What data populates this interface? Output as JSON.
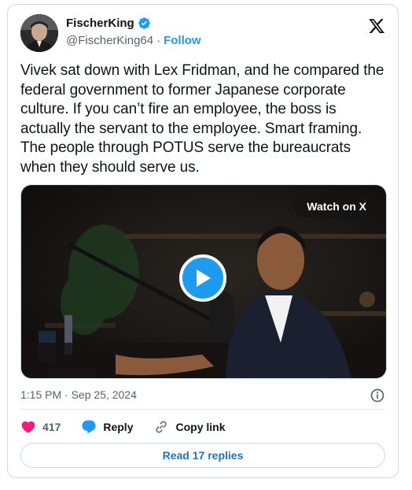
{
  "author": {
    "display_name": "FischerKing",
    "handle": "@FischerKing64",
    "separator": "·",
    "follow_label": "Follow"
  },
  "tweet": {
    "text": "Vivek sat down with Lex Fridman, and he compared the federal government to former Japanese corporate culture. If you can’t fire an employee, the boss is actually the servant to the employee. Smart framing. The people through POTUS serve the bureaucrats when they should serve us."
  },
  "media": {
    "watch_label": "Watch on X"
  },
  "meta": {
    "timestamp": "1:15 PM · Sep 25, 2024"
  },
  "actions": {
    "likes_count": "417",
    "reply_label": "Reply",
    "copy_link_label": "Copy link"
  },
  "replies_button_label": "Read 17 replies",
  "colors": {
    "accent": "#1d9bf0",
    "like": "#f91880",
    "text": "#0f1419",
    "muted": "#536471"
  }
}
